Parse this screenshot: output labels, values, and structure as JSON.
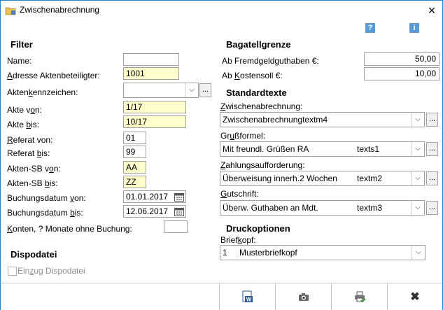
{
  "window": {
    "title": "Zwischenabrechnung",
    "close_glyph": "×"
  },
  "toolbar": {
    "help_glyph": "?",
    "info_glyph": "i"
  },
  "filter": {
    "heading": "Filter",
    "name": {
      "label": "Name:",
      "value": ""
    },
    "adresse": {
      "label_u": "A",
      "label_rest": "dresse Aktenbeteiligter:",
      "value": "1001"
    },
    "aktenkennzeichen": {
      "label_pre": "Akten",
      "label_u": "k",
      "label_rest": "ennzeichen:",
      "value": ""
    },
    "akte_von": {
      "label_pre": "Akte v",
      "label_u": "o",
      "label_rest": "n:",
      "value": "1/17"
    },
    "akte_bis": {
      "label_pre": "Akte ",
      "label_u": "b",
      "label_rest": "is:",
      "value": "10/17"
    },
    "referat_von": {
      "label_u": "R",
      "label_rest": "eferat von:",
      "value": "01"
    },
    "referat_bis": {
      "label_pre": "Referat ",
      "label_u": "b",
      "label_rest": "is:",
      "value": "99"
    },
    "sb_von": {
      "label_pre": "Akten-SB v",
      "label_u": "o",
      "label_rest": "n:",
      "value": "AA"
    },
    "sb_bis": {
      "label_pre": "Akten-SB ",
      "label_u": "b",
      "label_rest": "is:",
      "value": "ZZ"
    },
    "buchung_von": {
      "label_pre": "Buchungsdatum ",
      "label_u": "v",
      "label_rest": "on:",
      "value": "01.01.2017"
    },
    "buchung_bis": {
      "label_pre": "Buchungsdatum ",
      "label_u": "b",
      "label_rest": "is:",
      "value": "12.06.2017"
    },
    "konten": {
      "label_u": "K",
      "label_rest": "onten, ? Monate ohne Buchung:",
      "value": ""
    },
    "dots": "..."
  },
  "dispo": {
    "heading": "Dispodatei",
    "einzug": {
      "label_pre": "Ein",
      "label_u": "z",
      "label_rest": "ug Dispodatei",
      "checked": false
    }
  },
  "bagatell": {
    "heading": "Bagatellgrenze",
    "fremdgeld": {
      "label": "Ab Fremdgeldguthaben  €:",
      "value": "50,00"
    },
    "kostensoll": {
      "label_pre": "Ab ",
      "label_u": "K",
      "label_rest": "ostensoll  €:",
      "value": "10,00"
    }
  },
  "standardtexte": {
    "heading": "Standardtexte",
    "zwischen": {
      "label_u": "Z",
      "label_rest": "wischenabrechnung:",
      "value": "Zwischenabrechnungtextm4",
      "code": ""
    },
    "gruss": {
      "label_pre": "Gr",
      "label_u": "u",
      "label_rest": "ßformel:",
      "value": "Mit freundl. Grüßen RA",
      "code": "texts1"
    },
    "zahlung": {
      "label_u": "Z",
      "label_rest": "ahlungsaufforderung:",
      "value": "Überweisung innerh.2 Wochen",
      "code": "textm2"
    },
    "gutschrift": {
      "label_u": "G",
      "label_rest": "utschrift:",
      "value": "Überw. Guthaben an Mdt.",
      "code": "textm3"
    }
  },
  "druck": {
    "heading": "Druckoptionen",
    "briefkopf": {
      "label_pre": "Brief",
      "label_u": "k",
      "label_rest": "opf:",
      "num": "1",
      "value": "Musterbriefkopf"
    }
  },
  "footer": {
    "buttons": [
      "word-export-icon",
      "camera-icon",
      "printer-icon",
      "close-icon"
    ],
    "close_glyph": "✖"
  }
}
